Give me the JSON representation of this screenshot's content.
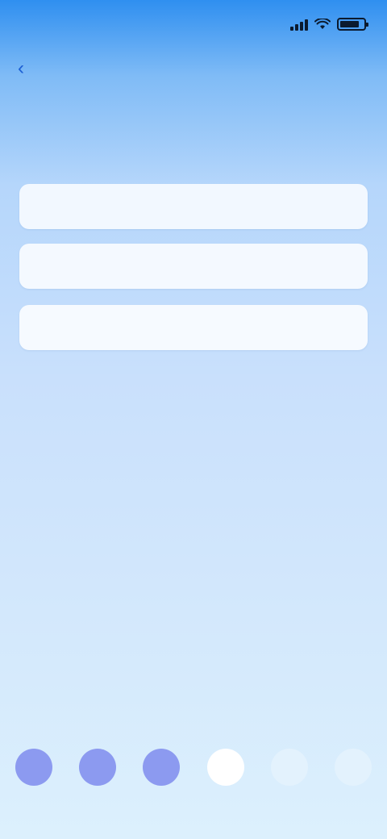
{
  "status_bar": {
    "time": "",
    "battery_level": 0.85
  },
  "header": {
    "back_label": "",
    "caption": "",
    "title": ""
  },
  "form": {
    "fields": [
      {
        "placeholder": "",
        "value": ""
      },
      {
        "placeholder": "",
        "value": ""
      },
      {
        "placeholder": "",
        "value": ""
      }
    ]
  },
  "bottom_bar": {
    "items": [
      {
        "label": "",
        "color": "#8c9af0"
      },
      {
        "label": "",
        "color": "#8c9af0"
      },
      {
        "label": "",
        "color": "#8c9af0"
      },
      {
        "label": "",
        "color": "#ffffff"
      },
      {
        "label": "",
        "color": "#e3f2fd"
      },
      {
        "label": "",
        "color": "#e3f2fd"
      }
    ]
  },
  "colors": {
    "accent": "#1c5fd4",
    "background_top": "#2f8ff0",
    "background_bottom": "#dcf0fd"
  }
}
